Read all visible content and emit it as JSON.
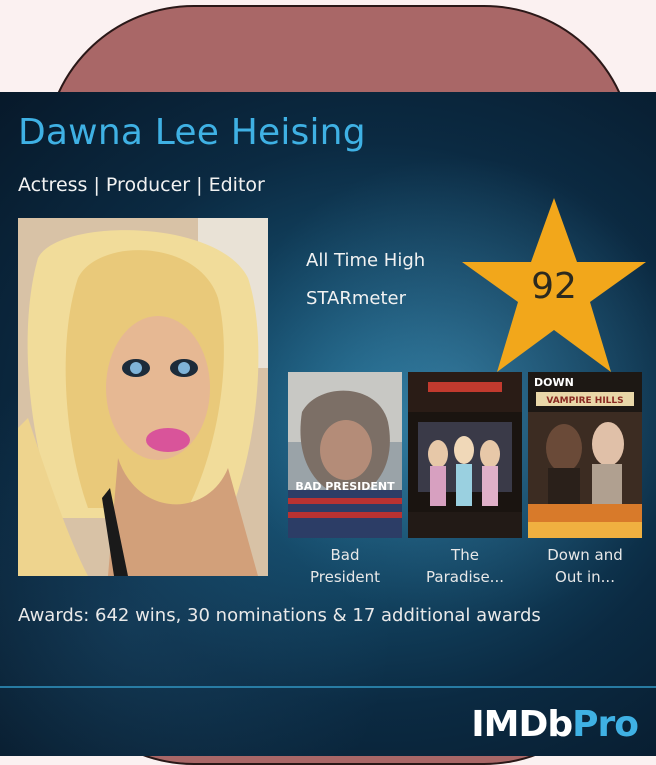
{
  "profile": {
    "name": "Dawna Lee Heising",
    "roles": "Actress | Producer | Editor",
    "photo_alt": "headshot-photo"
  },
  "starmeter": {
    "label_line1": "All Time High",
    "label_line2": "STARmeter",
    "value": "92",
    "star_color": "#f2a71b"
  },
  "known_for": [
    {
      "title_line1": "Bad",
      "title_line2": "President"
    },
    {
      "title_line1": "The",
      "title_line2": "Paradise..."
    },
    {
      "title_line1": "Down and",
      "title_line2": "Out in..."
    }
  ],
  "posters": {
    "poster3_top_text": "DOWN",
    "poster3_mid_text": "VAMPIRE HILLS",
    "poster1_text": "BAD PRESIDENT"
  },
  "awards": {
    "text": "Awards: 642 wins, 30 nominations & 17 additional awards"
  },
  "brand": {
    "imdb": "IMDb",
    "pro": "Pro",
    "accent_color": "#3fb1e4"
  }
}
